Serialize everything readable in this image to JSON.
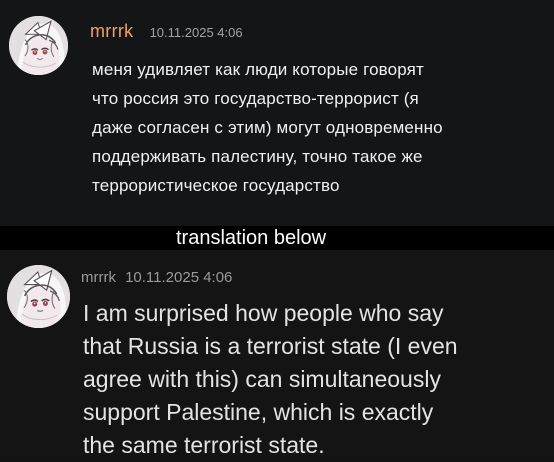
{
  "original_message": {
    "author": "mrrrk",
    "timestamp": "10.11.2025 4:06",
    "lines": [
      "меня удивляет как люди которые говорят",
      "что россия это государство-террорист (я",
      "даже согласен с этим) могут одновременно",
      "поддерживать палестину, точно такое же",
      "террористическое государство"
    ]
  },
  "translation_label": "translation below",
  "translated_message": {
    "author": "mrrrk",
    "timestamp": "10.11.2025 4:06",
    "lines": [
      "I am surprised how people who say",
      "that Russia is a terrorist state (I even",
      "agree with this) can simultaneously",
      "support Palestine, which is exactly",
      "the same terrorist state."
    ]
  },
  "colors": {
    "background": "#111214",
    "top_panel": "#141517",
    "bottom_panel": "#141414",
    "username_accent": "#f6a15b",
    "meta_text": "#a3a3a8",
    "message_text": "#f1f1f1"
  },
  "icons": {
    "top_avatar": "anime-avatar-icon",
    "bottom_avatar": "anime-avatar-icon"
  }
}
